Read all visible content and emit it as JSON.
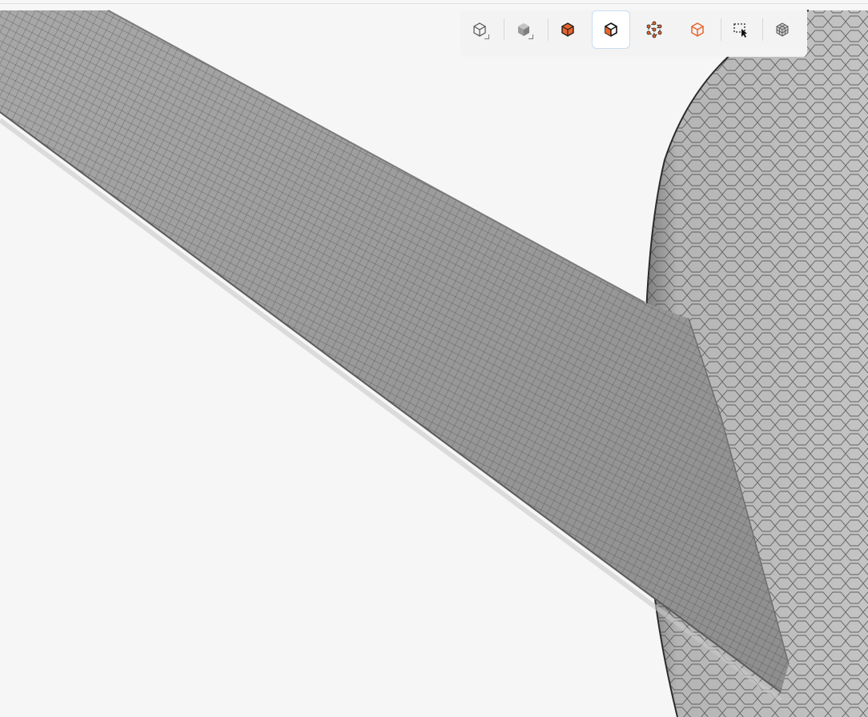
{
  "viewer": {
    "background_color": "#f6f6f6",
    "mesh_color": "#a9a9a9",
    "edge_color": "#3c3c3c"
  },
  "toolbar": {
    "accent_color": "#e8642c",
    "buttons": [
      {
        "name": "view-outline-icon",
        "active": false
      },
      {
        "name": "view-shaded-icon",
        "active": false
      },
      {
        "name": "select-solid-icon",
        "active": false
      },
      {
        "name": "select-face-icon",
        "active": true
      },
      {
        "name": "select-vertex-icon",
        "active": false
      },
      {
        "name": "select-edge-icon",
        "active": false
      },
      {
        "name": "box-select-icon",
        "active": false
      },
      {
        "name": "mesh-display-icon",
        "active": false
      }
    ]
  }
}
